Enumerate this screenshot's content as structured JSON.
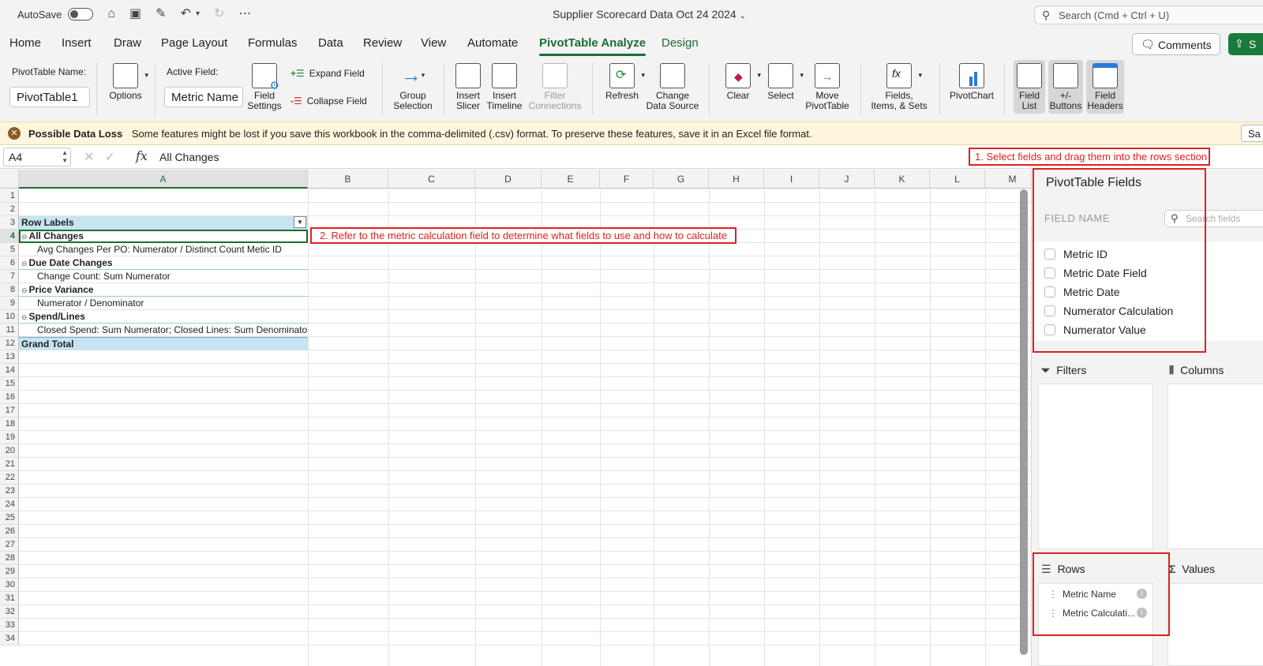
{
  "titlebar": {
    "autosave_label": "AutoSave",
    "doc_title": "Supplier Scorecard Data Oct 24 2024",
    "search_placeholder": "Search (Cmd + Ctrl + U)"
  },
  "menu": {
    "items": [
      "Home",
      "Insert",
      "Draw",
      "Page Layout",
      "Formulas",
      "Data",
      "Review",
      "View",
      "Automate",
      "PivotTable Analyze",
      "Design"
    ],
    "active": "PivotTable Analyze",
    "comments_label": "Comments",
    "share_label": "S"
  },
  "ribbon": {
    "pivot_name_label": "PivotTable Name:",
    "pivot_name_value": "PivotTable1",
    "options": "Options",
    "active_field_label": "Active Field:",
    "active_field_value": "Metric Name",
    "field_settings_1": "Field",
    "field_settings_2": "Settings",
    "expand_field": "Expand Field",
    "collapse_field": "Collapse Field",
    "group_1": "Group",
    "group_2": "Selection",
    "insert_slicer_1": "Insert",
    "insert_slicer_2": "Slicer",
    "insert_timeline_1": "Insert",
    "insert_timeline_2": "Timeline",
    "filter_conn_1": "Filter",
    "filter_conn_2": "Connections",
    "refresh": "Refresh",
    "change_ds_1": "Change",
    "change_ds_2": "Data Source",
    "clear": "Clear",
    "select": "Select",
    "move_1": "Move",
    "move_2": "PivotTable",
    "fields_items_1": "Fields,",
    "fields_items_2": "Items, & Sets",
    "pivotchart": "PivotChart",
    "field_list_1": "Field",
    "field_list_2": "List",
    "buttons_1": "+/-",
    "buttons_2": "Buttons",
    "field_headers_1": "Field",
    "field_headers_2": "Headers"
  },
  "message_bar": {
    "title": "Possible Data Loss",
    "text": "Some features might be lost if you save this workbook in the comma-delimited (.csv) format. To preserve these features, save it in an Excel file format.",
    "button": "Sa"
  },
  "formula_bar": {
    "name_box": "A4",
    "fx": "fx",
    "value": "All Changes"
  },
  "annotations": {
    "note1": "1. Select fields and drag them into the rows section",
    "note2": "2. Refer to the metric calculation field to determine what fields to use and how to calculate"
  },
  "sheet": {
    "columns": [
      "A",
      "B",
      "C",
      "D",
      "E",
      "F",
      "G",
      "H",
      "I",
      "J",
      "K",
      "L",
      "M"
    ],
    "rows": [
      "1",
      "2",
      "3",
      "4",
      "5",
      "6",
      "7",
      "8",
      "9",
      "10",
      "11",
      "12",
      "13",
      "14",
      "15",
      "16",
      "17",
      "18",
      "19",
      "20",
      "21",
      "22",
      "23",
      "24",
      "25",
      "26",
      "27",
      "28",
      "29",
      "30",
      "31",
      "32",
      "33",
      "34"
    ],
    "cells": {
      "a3": "Row Labels",
      "a4": "All Changes",
      "a5": "Avg Changes Per PO: Numerator / Distinct Count Metic ID",
      "a6": "Due Date Changes",
      "a7": "Change Count: Sum Numerator",
      "a8": "Price Variance",
      "a9": "Numerator / Denominator",
      "a10": "Spend/Lines",
      "a11": "Closed Spend: Sum Numerator; Closed Lines: Sum Denominator",
      "a12": "Grand Total"
    }
  },
  "panel": {
    "title": "PivotTable Fields",
    "field_name_label": "FIELD NAME",
    "search_placeholder": "Search fields",
    "fields": [
      "Metric ID",
      "Metric Date Field",
      "Metric Date",
      "Numerator Calculation",
      "Numerator Value"
    ],
    "filters_label": "Filters",
    "columns_label": "Columns",
    "rows_label": "Rows",
    "values_label": "Values",
    "rows_items": [
      "Metric Name",
      "Metric Calculati..."
    ]
  }
}
